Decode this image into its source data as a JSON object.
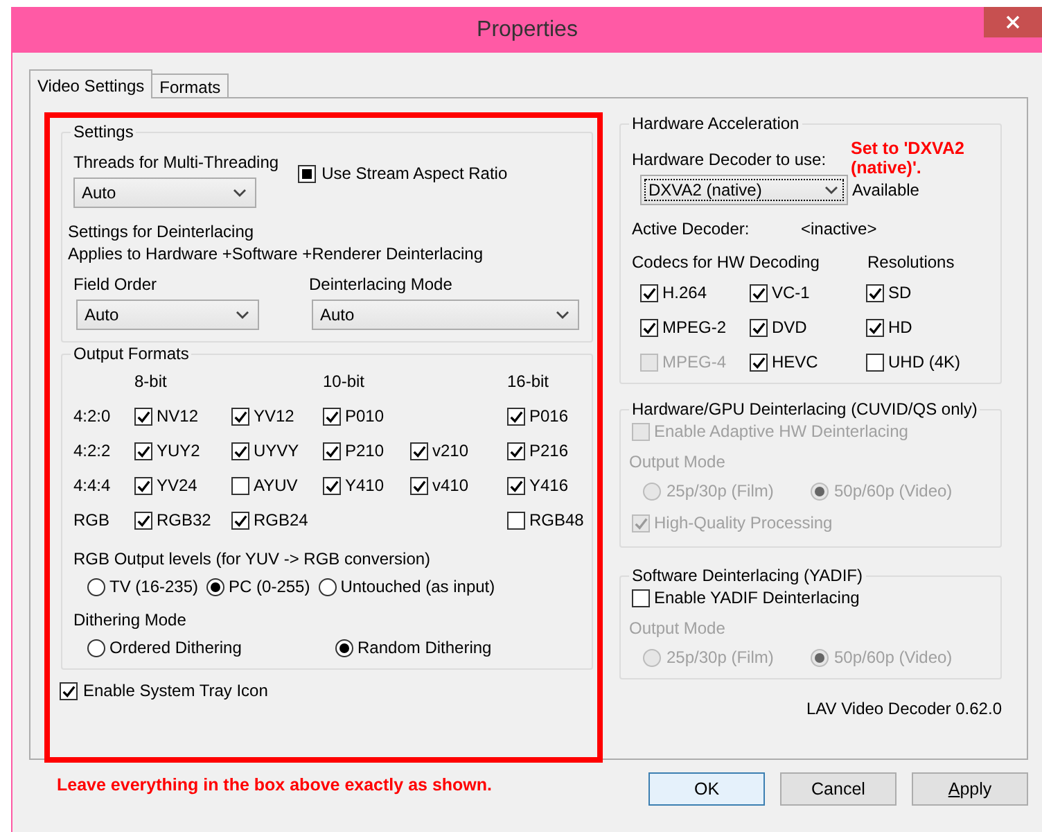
{
  "window": {
    "title": "Properties"
  },
  "tabs": [
    {
      "label": "Video Settings",
      "selected": true
    },
    {
      "label": "Formats",
      "selected": false
    }
  ],
  "settings": {
    "title": "Settings",
    "threads": {
      "label": "Threads for Multi-Threading",
      "value": "Auto"
    },
    "aspect": {
      "label": "Use Stream Aspect Ratio",
      "indeterminate": true
    },
    "deint_heading": "Settings for Deinterlacing",
    "deint_note": "Applies to Hardware +Software +Renderer Deinterlacing",
    "field_order": {
      "label": "Field Order",
      "value": "Auto"
    },
    "deint_mode": {
      "label": "Deinterlacing Mode",
      "value": "Auto"
    }
  },
  "output_formats": {
    "title": "Output Formats",
    "columns": [
      "8-bit",
      "10-bit",
      "16-bit"
    ],
    "rows": [
      {
        "label": "4:2:0",
        "eight_bit": [
          {
            "name": "NV12",
            "checked": true
          },
          {
            "name": "YV12",
            "checked": true
          }
        ],
        "ten_bit": [
          {
            "name": "P010",
            "checked": true
          }
        ],
        "sixteen_bit": [
          {
            "name": "P016",
            "checked": true
          }
        ]
      },
      {
        "label": "4:2:2",
        "eight_bit": [
          {
            "name": "YUY2",
            "checked": true
          },
          {
            "name": "UYVY",
            "checked": true
          }
        ],
        "ten_bit": [
          {
            "name": "P210",
            "checked": true
          },
          {
            "name": "v210",
            "checked": true
          }
        ],
        "sixteen_bit": [
          {
            "name": "P216",
            "checked": true
          }
        ]
      },
      {
        "label": "4:4:4",
        "eight_bit": [
          {
            "name": "YV24",
            "checked": true
          },
          {
            "name": "AYUV",
            "checked": false
          }
        ],
        "ten_bit": [
          {
            "name": "Y410",
            "checked": true
          },
          {
            "name": "v410",
            "checked": true
          }
        ],
        "sixteen_bit": [
          {
            "name": "Y416",
            "checked": true
          }
        ]
      },
      {
        "label": "RGB",
        "eight_bit": [
          {
            "name": "RGB32",
            "checked": true
          },
          {
            "name": "RGB24",
            "checked": true
          }
        ],
        "sixteen_bit": [
          {
            "name": "RGB48",
            "checked": false
          }
        ]
      }
    ],
    "rgb_levels": {
      "label": "RGB Output levels (for YUV -> RGB conversion)",
      "options": [
        {
          "label": "TV (16-235)",
          "selected": false
        },
        {
          "label": "PC (0-255)",
          "selected": true
        },
        {
          "label": "Untouched (as input)",
          "selected": false
        }
      ]
    },
    "dithering": {
      "label": "Dithering Mode",
      "options": [
        {
          "label": "Ordered Dithering",
          "selected": false
        },
        {
          "label": "Random Dithering",
          "selected": true
        }
      ]
    }
  },
  "tray": {
    "label": "Enable System Tray Icon",
    "checked": true
  },
  "note": "Leave everything in the box above exactly as shown.",
  "hw_accel": {
    "title": "Hardware Acceleration",
    "decoder_label": "Hardware Decoder to use:",
    "note": "Set to 'DXVA2 (native)'.",
    "decoder_value": "DXVA2 (native)",
    "status": "Available",
    "active_label": "Active Decoder:",
    "active_value": "<inactive>",
    "codecs_label": "Codecs for HW Decoding",
    "resolutions_label": "Resolutions",
    "codecs": [
      {
        "label": "H.264",
        "checked": true,
        "disabled": false
      },
      {
        "label": "VC-1",
        "checked": true,
        "disabled": false
      },
      {
        "label": "MPEG-2",
        "checked": true,
        "disabled": false
      },
      {
        "label": "DVD",
        "checked": true,
        "disabled": false
      },
      {
        "label": "MPEG-4",
        "checked": false,
        "disabled": true
      },
      {
        "label": "HEVC",
        "checked": true,
        "disabled": false
      }
    ],
    "resolutions": [
      {
        "label": "SD",
        "checked": true,
        "disabled": false
      },
      {
        "label": "HD",
        "checked": true,
        "disabled": false
      },
      {
        "label": "UHD (4K)",
        "checked": false,
        "disabled": false
      }
    ]
  },
  "hw_deint": {
    "title": "Hardware/GPU Deinterlacing (CUVID/QS only)",
    "enable": {
      "label": "Enable Adaptive HW Deinterlacing",
      "checked": false,
      "disabled": true
    },
    "mode_label": "Output Mode",
    "modes": [
      {
        "label": "25p/30p (Film)",
        "selected": false,
        "disabled": true
      },
      {
        "label": "50p/60p (Video)",
        "selected": true,
        "disabled": true
      }
    ],
    "hq": {
      "label": "High-Quality Processing",
      "checked": true,
      "disabled": true
    }
  },
  "sw_deint": {
    "title": "Software Deinterlacing (YADIF)",
    "enable": {
      "label": "Enable YADIF Deinterlacing",
      "checked": false,
      "disabled": false
    },
    "mode_label": "Output Mode",
    "modes": [
      {
        "label": "25p/30p (Film)",
        "selected": false,
        "disabled": true
      },
      {
        "label": "50p/60p (Video)",
        "selected": true,
        "disabled": true
      }
    ]
  },
  "version": "LAV Video Decoder 0.62.0",
  "buttons": [
    {
      "label": "OK",
      "kind": "default"
    },
    {
      "label": "Cancel",
      "kind": "normal"
    },
    {
      "label": "Apply",
      "kind": "normal"
    }
  ]
}
